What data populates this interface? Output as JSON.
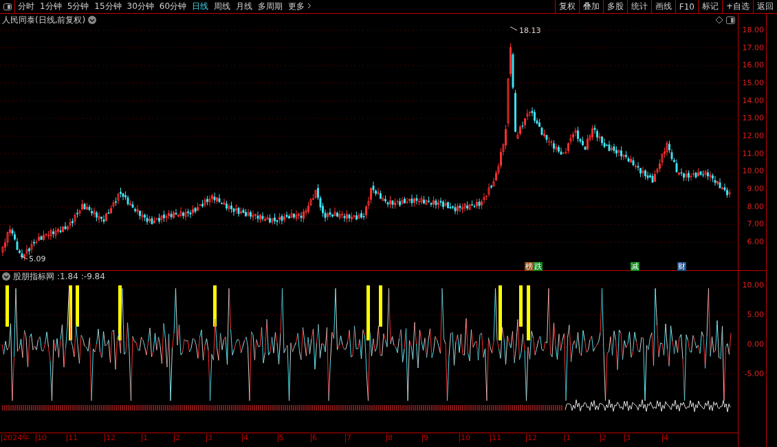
{
  "toolbar": {
    "periods": [
      {
        "label": "分时",
        "selected": false
      },
      {
        "label": "1分钟",
        "selected": false
      },
      {
        "label": "5分钟",
        "selected": false
      },
      {
        "label": "15分钟",
        "selected": false
      },
      {
        "label": "30分钟",
        "selected": false
      },
      {
        "label": "60分钟",
        "selected": false
      },
      {
        "label": "日线",
        "selected": true
      },
      {
        "label": "周线",
        "selected": false
      },
      {
        "label": "月线",
        "selected": false
      },
      {
        "label": "多周期",
        "selected": false
      }
    ],
    "more": "更多",
    "actions": [
      "复权",
      "叠加",
      "多股",
      "统计",
      "画线",
      "F10",
      "标记",
      "+自选",
      "返回"
    ]
  },
  "chart": {
    "title": "人民同泰(日线,前复权)",
    "price_axis": [
      "18.00",
      "17.00",
      "16.00",
      "15.00",
      "14.00",
      "13.00",
      "12.00",
      "11.00",
      "10.00",
      "9.00",
      "8.00",
      "7.00",
      "6.00"
    ],
    "high_label": "18.13",
    "low_label": "5.09",
    "events": [
      {
        "text": "榜",
        "color": "#8b4a12"
      },
      {
        "text": "跌",
        "color": "#118a1c"
      },
      {
        "text": "减",
        "color": "#118a1c"
      },
      {
        "text": "财",
        "color": "#1c4f8c"
      }
    ]
  },
  "indicator": {
    "name": "股朋指标网",
    "values": [
      ":1.84",
      ":-9.84"
    ],
    "axis": [
      "10.00",
      "5.00",
      "0.00",
      "-5.00"
    ]
  },
  "time_axis": [
    "2024年",
    "10",
    "11",
    "12",
    "1",
    "2",
    "3",
    "4",
    "5",
    "6",
    "7",
    "8",
    "9",
    "10",
    "11",
    "12",
    "1",
    "2",
    "3",
    "4"
  ]
}
